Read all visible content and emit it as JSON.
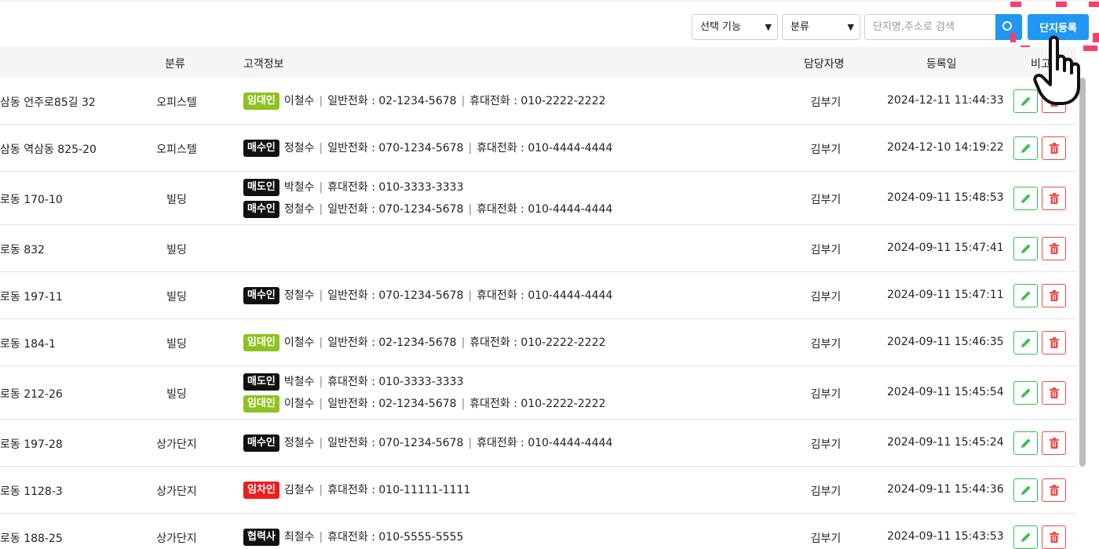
{
  "toolbar": {
    "select_function": "선택 기능",
    "select_category": "분류",
    "search_placeholder": "단지명,주소로 검색",
    "register_label": "단지등록"
  },
  "table": {
    "headers": {
      "category": "분류",
      "customer": "고객정보",
      "manager": "담당자명",
      "date": "등록일",
      "note": "비고"
    },
    "rows": [
      {
        "address": "삼동 언주로85길 32",
        "category": "오피스텔",
        "manager": "김부기",
        "date": "2024-12-11 11:44:33",
        "customers": [
          {
            "role": "임대인",
            "name": "이철수",
            "phones": [
              "일반전화 : 02-1234-5678",
              "휴대전화 : 010-2222-2222"
            ]
          }
        ]
      },
      {
        "address": "삼동 역삼동 825-20",
        "category": "오피스텔",
        "manager": "김부기",
        "date": "2024-12-10 14:19:22",
        "customers": [
          {
            "role": "매수인",
            "name": "정철수",
            "phones": [
              "일반전화 : 070-1234-5678",
              "휴대전화 : 010-4444-4444"
            ]
          }
        ]
      },
      {
        "address": "로동 170-10",
        "category": "빌딩",
        "manager": "김부기",
        "date": "2024-09-11 15:48:53",
        "customers": [
          {
            "role": "매도인",
            "name": "박철수",
            "phones": [
              "휴대전화 : 010-3333-3333"
            ]
          },
          {
            "role": "매수인",
            "name": "정철수",
            "phones": [
              "일반전화 : 070-1234-5678",
              "휴대전화 : 010-4444-4444"
            ]
          }
        ]
      },
      {
        "address": "로동 832",
        "category": "빌딩",
        "manager": "김부기",
        "date": "2024-09-11 15:47:41",
        "customers": []
      },
      {
        "address": "로동 197-11",
        "category": "빌딩",
        "manager": "김부기",
        "date": "2024-09-11 15:47:11",
        "customers": [
          {
            "role": "매수인",
            "name": "정철수",
            "phones": [
              "일반전화 : 070-1234-5678",
              "휴대전화 : 010-4444-4444"
            ]
          }
        ]
      },
      {
        "address": "로동 184-1",
        "category": "빌딩",
        "manager": "김부기",
        "date": "2024-09-11 15:46:35",
        "customers": [
          {
            "role": "임대인",
            "name": "이철수",
            "phones": [
              "일반전화 : 02-1234-5678",
              "휴대전화 : 010-2222-2222"
            ]
          }
        ]
      },
      {
        "address": "로동 212-26",
        "category": "빌딩",
        "manager": "김부기",
        "date": "2024-09-11 15:45:54",
        "customers": [
          {
            "role": "매도인",
            "name": "박철수",
            "phones": [
              "휴대전화 : 010-3333-3333"
            ]
          },
          {
            "role": "임대인",
            "name": "이철수",
            "phones": [
              "일반전화 : 02-1234-5678",
              "휴대전화 : 010-2222-2222"
            ]
          }
        ]
      },
      {
        "address": "로동 197-28",
        "category": "상가단지",
        "manager": "김부기",
        "date": "2024-09-11 15:45:24",
        "customers": [
          {
            "role": "매수인",
            "name": "정철수",
            "phones": [
              "일반전화 : 070-1234-5678",
              "휴대전화 : 010-4444-4444"
            ]
          }
        ]
      },
      {
        "address": "로동 1128-3",
        "category": "상가단지",
        "manager": "김부기",
        "date": "2024-09-11 15:44:36",
        "customers": [
          {
            "role": "임차인",
            "name": "김철수",
            "phones": [
              "휴대전화 : 010-11111-1111"
            ]
          }
        ]
      },
      {
        "address": "로동 188-25",
        "category": "상가단지",
        "manager": "김부기",
        "date": "2024-09-11 15:43:53",
        "customers": [
          {
            "role": "협력사",
            "name": "최철수",
            "phones": [
              "휴대전화 : 010-5555-5555"
            ]
          }
        ]
      }
    ]
  },
  "role_colors": {
    "임대인": "#8ec21f",
    "매수인": "#111111",
    "매도인": "#111111",
    "임차인": "#ef1c1c",
    "협력사": "#111111"
  },
  "icons": {
    "edit": "pencil-icon",
    "delete": "trash-icon",
    "search": "search-icon",
    "cursor": "hand-pointer-icon"
  },
  "colors": {
    "primary": "#2196f3",
    "edit": "#33c24f",
    "delete": "#f24b45",
    "highlight": "#ff3d6b"
  }
}
